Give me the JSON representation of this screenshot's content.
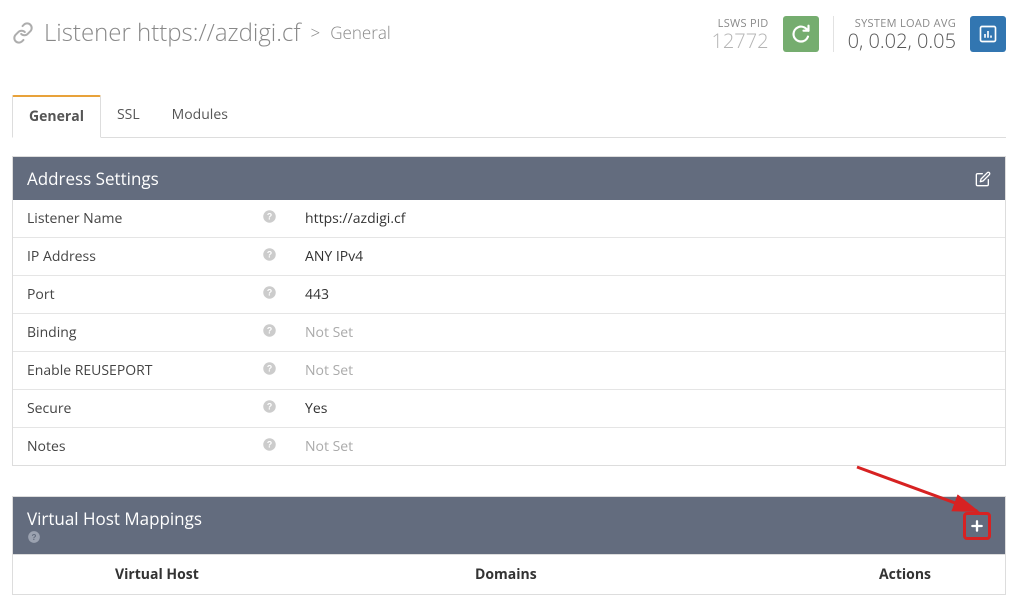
{
  "header": {
    "title_prefix": "Listener",
    "title_name": "https://azdigi.cf",
    "breadcrumb_current": "General"
  },
  "stats": {
    "pid_label": "LSWS PID",
    "pid_value": "12772",
    "load_label": "SYSTEM LOAD AVG",
    "load_value": "0, 0.02, 0.05"
  },
  "tabs": [
    {
      "label": "General",
      "active": true
    },
    {
      "label": "SSL",
      "active": false
    },
    {
      "label": "Modules",
      "active": false
    }
  ],
  "address_panel": {
    "title": "Address Settings",
    "rows": [
      {
        "label": "Listener Name",
        "value": "https://azdigi.cf",
        "not_set": false
      },
      {
        "label": "IP Address",
        "value": "ANY IPv4",
        "not_set": false
      },
      {
        "label": "Port",
        "value": "443",
        "not_set": false
      },
      {
        "label": "Binding",
        "value": "Not Set",
        "not_set": true
      },
      {
        "label": "Enable REUSEPORT",
        "value": "Not Set",
        "not_set": true
      },
      {
        "label": "Secure",
        "value": "Yes",
        "not_set": false
      },
      {
        "label": "Notes",
        "value": "Not Set",
        "not_set": true
      }
    ]
  },
  "vhm_panel": {
    "title": "Virtual Host Mappings",
    "columns": [
      "Virtual Host",
      "Domains",
      "Actions"
    ]
  }
}
